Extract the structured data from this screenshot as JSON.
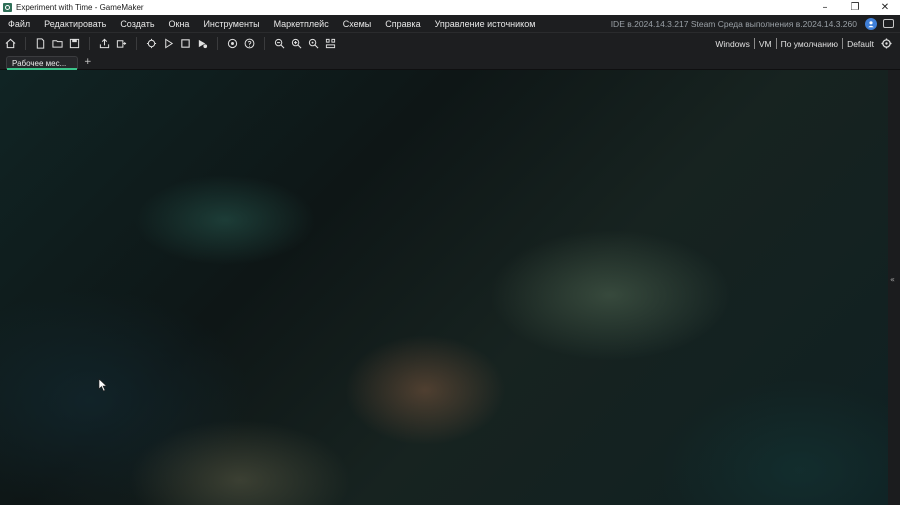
{
  "window": {
    "title": "Experiment with Time - GameMaker",
    "minimize": "–",
    "restore": "❐",
    "close": "✕"
  },
  "menubar": {
    "items": [
      "Файл",
      "Редактировать",
      "Создать",
      "Окна",
      "Инструменты",
      "Маркетплейс",
      "Схемы",
      "Справка",
      "Управление источником"
    ],
    "ide_version": "IDE в.2024.14.3.217 Steam  Среда выполнения в.2024.14.3.260",
    "account_icon": "user-circle-icon",
    "chat_icon": "chat-icon"
  },
  "toolbar": {
    "targets": [
      "Windows",
      "VM",
      "По умолчанию",
      "Default"
    ],
    "icons": [
      "home-icon",
      "new-project-icon",
      "open-project-icon",
      "save-icon",
      "export-icon",
      "import-icon",
      "clean-icon",
      "run-icon",
      "stop-icon",
      "debug-icon",
      "settings-icon",
      "help-icon",
      "zoom-out-icon",
      "zoom-in-icon",
      "zoom-reset-icon",
      "grid-icon",
      "target-settings-icon"
    ]
  },
  "tabs": {
    "active_label": "Рабочее мес...",
    "add_label": "+"
  },
  "right_panel": {
    "handle": "«"
  },
  "colors": {
    "accent": "#3bc48a",
    "chrome": "#1d1e20",
    "workspace": "#101818"
  }
}
